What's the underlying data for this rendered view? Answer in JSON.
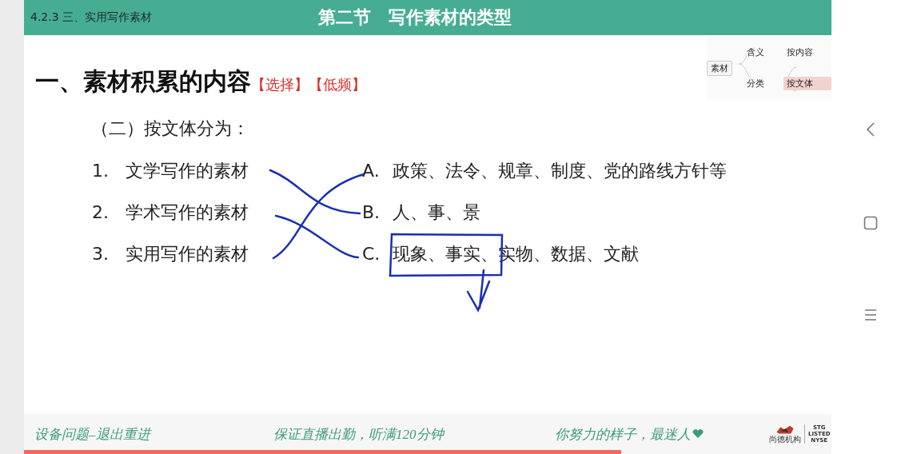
{
  "header": {
    "section": "4.2.3 三、实用写作素材",
    "title": "第二节　写作素材的类型"
  },
  "heading": {
    "text": "一、素材积累的内容",
    "tags": [
      "【选择】",
      "【低频】"
    ]
  },
  "mind_map": {
    "root": "素材",
    "children": [
      {
        "label": "含义"
      },
      {
        "label": "分类",
        "children": [
          {
            "label": "按内容",
            "selected": false
          },
          {
            "label": "按文体",
            "selected": true
          }
        ]
      }
    ]
  },
  "subheading": "（二）按文体分为：",
  "left_items": [
    {
      "number": "1.",
      "text": "文学写作的素材"
    },
    {
      "number": "2.",
      "text": "学术写作的素材"
    },
    {
      "number": "3.",
      "text": "实用写作的素材"
    }
  ],
  "right_items": [
    {
      "letter": "A.",
      "text": "政策、法令、规章、制度、党的路线方针等"
    },
    {
      "letter": "B.",
      "text": "人、事、景"
    },
    {
      "letter": "C.",
      "text": "现象、事实、实物、数据、文献"
    }
  ],
  "footer": {
    "notices": [
      "设备问题–退出重进",
      "保证直播出勤，听满120分钟",
      "你努力的样子，最迷人"
    ]
  },
  "logo": {
    "name": "尚德机构",
    "exchange": [
      "STG",
      "LISTED",
      "NYSE"
    ]
  },
  "progress": {
    "level": 0.74
  }
}
